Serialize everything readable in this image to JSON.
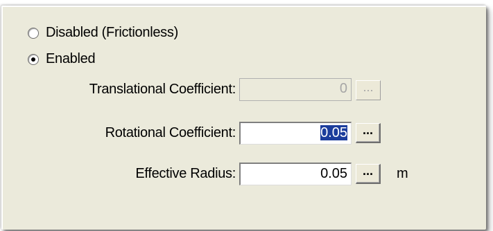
{
  "friction": {
    "options": [
      {
        "label": "Disabled (Frictionless)",
        "checked": false
      },
      {
        "label": "Enabled",
        "checked": true
      }
    ]
  },
  "fields": {
    "translational": {
      "label": "Translational Coefficient:",
      "value": "0",
      "button": "...",
      "enabled": false
    },
    "rotational": {
      "label": "Rotational Coefficient:",
      "value": "0.05",
      "button": "...",
      "enabled": true,
      "value_selected": true
    },
    "radius": {
      "label": "Effective Radius:",
      "value": "0.05",
      "button": "...",
      "enabled": true,
      "unit": "m"
    }
  }
}
